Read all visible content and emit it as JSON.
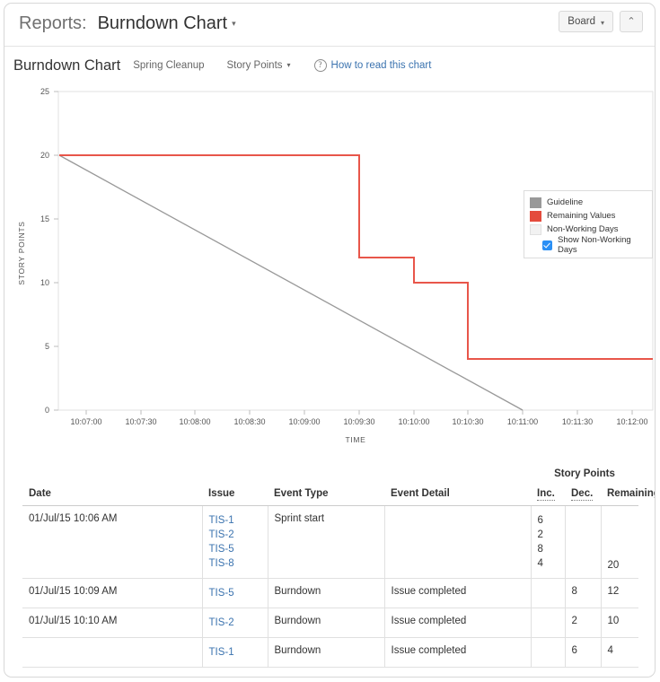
{
  "header": {
    "label": "Reports:",
    "report_name": "Burndown Chart",
    "caret": "▾",
    "board_button": "Board",
    "board_caret": "▾",
    "collapse_icon": "⌃"
  },
  "subheader": {
    "chart_heading": "Burndown Chart",
    "sprint": "Spring Cleanup",
    "unit": "Story Points",
    "unit_caret": "▾",
    "help_icon": "?",
    "help_text": "How to read this chart"
  },
  "legend": {
    "items": [
      {
        "label": "Guideline",
        "color": "#999999"
      },
      {
        "label": "Remaining Values",
        "color": "#e44b3c"
      },
      {
        "label": "Non-Working Days",
        "color": "#f2f2f2"
      }
    ],
    "checkbox_label": "Show Non-Working Days",
    "checkbox_checked": true
  },
  "chart_data": {
    "type": "line",
    "title": "Burndown Chart",
    "xlabel": "TIME",
    "ylabel": "STORY POINTS",
    "ylim": [
      0,
      25
    ],
    "yticks": [
      0,
      5,
      10,
      15,
      20,
      25
    ],
    "xticks": [
      "10:07:00",
      "10:07:30",
      "10:08:00",
      "10:08:30",
      "10:09:00",
      "10:09:30",
      "10:10:00",
      "10:10:30",
      "10:11:00",
      "10:11:30",
      "10:12:00"
    ],
    "xlim_seconds": [
      41190,
      41550
    ],
    "grid": false,
    "legend_position": "top-right",
    "series": [
      {
        "name": "Guideline",
        "color": "#999999",
        "style": "line",
        "points": [
          {
            "x": "10:06:45",
            "y": 20
          },
          {
            "x": "10:11:00",
            "y": 0
          }
        ]
      },
      {
        "name": "Remaining Values",
        "color": "#e44b3c",
        "style": "step",
        "points": [
          {
            "x": "10:06:45",
            "y": 20
          },
          {
            "x": "10:09:30",
            "y": 20
          },
          {
            "x": "10:09:30",
            "y": 12
          },
          {
            "x": "10:10:00",
            "y": 12
          },
          {
            "x": "10:10:00",
            "y": 10
          },
          {
            "x": "10:10:30",
            "y": 10
          },
          {
            "x": "10:10:30",
            "y": 4
          },
          {
            "x": "10:12:10",
            "y": 4
          }
        ]
      }
    ]
  },
  "table": {
    "group_header": "Story Points",
    "columns": [
      "Date",
      "Issue",
      "Event Type",
      "Event Detail",
      "Inc.",
      "Dec.",
      "Remaining"
    ],
    "rows": [
      {
        "date": "01/Jul/15 10:06 AM",
        "issues": [
          "TIS-1",
          "TIS-2",
          "TIS-5",
          "TIS-8"
        ],
        "event_type": "Sprint start",
        "event_detail": "",
        "inc": [
          "6",
          "2",
          "8",
          "4"
        ],
        "dec": "",
        "remaining": "20"
      },
      {
        "date": "01/Jul/15 10:09 AM",
        "issues": [
          "TIS-5"
        ],
        "event_type": "Burndown",
        "event_detail": "Issue completed",
        "inc": [],
        "dec": "8",
        "remaining": "12"
      },
      {
        "date": "01/Jul/15 10:10 AM",
        "issues": [
          "TIS-2"
        ],
        "event_type": "Burndown",
        "event_detail": "Issue completed",
        "inc": [],
        "dec": "2",
        "remaining": "10"
      },
      {
        "date": "",
        "issues": [
          "TIS-1"
        ],
        "event_type": "Burndown",
        "event_detail": "Issue completed",
        "inc": [],
        "dec": "6",
        "remaining": "4"
      }
    ]
  }
}
